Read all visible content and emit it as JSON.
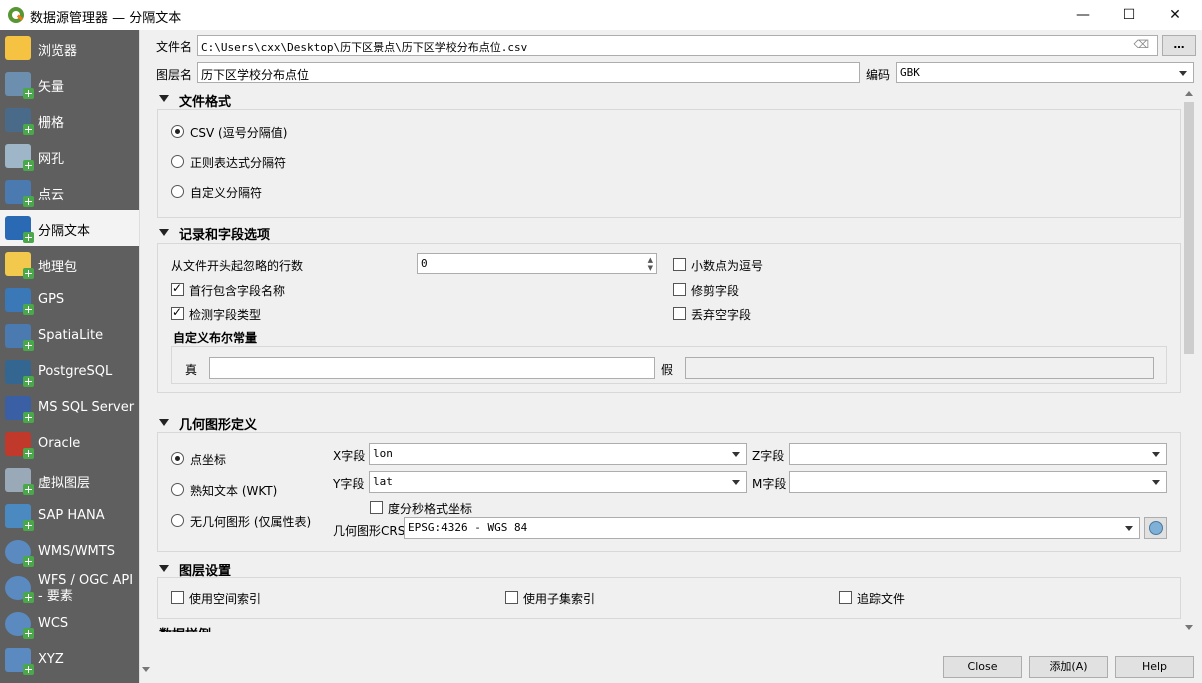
{
  "window": {
    "title": "数据源管理器 — 分隔文本",
    "minimize": "—",
    "maximize": "☐",
    "close": "✕"
  },
  "sidebar": {
    "items": [
      {
        "label": "浏览器",
        "icon": "folder-icon"
      },
      {
        "label": "矢量",
        "icon": "vector-icon"
      },
      {
        "label": "栅格",
        "icon": "raster-icon"
      },
      {
        "label": "网孔",
        "icon": "mesh-icon"
      },
      {
        "label": "点云",
        "icon": "point-cloud-icon"
      },
      {
        "label": "分隔文本",
        "icon": "delimited-text-icon"
      },
      {
        "label": "地理包",
        "icon": "geopackage-icon"
      },
      {
        "label": "GPS",
        "icon": "gps-icon"
      },
      {
        "label": "SpatiaLite",
        "icon": "spatialite-icon"
      },
      {
        "label": "PostgreSQL",
        "icon": "postgresql-icon"
      },
      {
        "label": "MS SQL Server",
        "icon": "mssql-icon"
      },
      {
        "label": "Oracle",
        "icon": "oracle-icon"
      },
      {
        "label": "虚拟图层",
        "icon": "virtual-layer-icon"
      },
      {
        "label": "SAP HANA",
        "icon": "sap-hana-icon"
      },
      {
        "label": "WMS/WMTS",
        "icon": "wms-icon"
      },
      {
        "label": "WFS / OGC API - 要素",
        "icon": "wfs-icon"
      },
      {
        "label": "WCS",
        "icon": "wcs-icon"
      },
      {
        "label": "XYZ",
        "icon": "xyz-icon"
      }
    ],
    "active": "分隔文本"
  },
  "file": {
    "label": "文件名",
    "value": "C:\\Users\\cxx\\Desktop\\历下区景点\\历下区学校分布点位.csv",
    "browse": "…"
  },
  "layer": {
    "label": "图层名",
    "value": "历下区学校分布点位",
    "encoding_label": "编码",
    "encoding_value": "GBK"
  },
  "file_format": {
    "title": "文件格式",
    "options": [
      "CSV (逗号分隔值)",
      "正则表达式分隔符",
      "自定义分隔符"
    ],
    "selected": "CSV (逗号分隔值)"
  },
  "record_options": {
    "title": "记录和字段选项",
    "skip_label": "从文件开头起忽略的行数",
    "skip_value": "0",
    "first_row_headers": {
      "label": "首行包含字段名称",
      "checked": true
    },
    "detect_types": {
      "label": "检测字段类型",
      "checked": true
    },
    "decimal_comma": {
      "label": "小数点为逗号",
      "checked": false
    },
    "trim_fields": {
      "label": "修剪字段",
      "checked": false
    },
    "discard_empty": {
      "label": "丢弃空字段",
      "checked": false
    },
    "custom_bool_title": "自定义布尔常量",
    "true_label": "真",
    "true_value": "",
    "false_label": "假",
    "false_value": ""
  },
  "geometry": {
    "title": "几何图形定义",
    "options": [
      "点坐标",
      "熟知文本 (WKT)",
      "无几何图形 (仅属性表)"
    ],
    "selected": "点坐标",
    "x_label": "X字段",
    "x_value": "lon",
    "y_label": "Y字段",
    "y_value": "lat",
    "z_label": "Z字段",
    "z_value": "",
    "m_label": "M字段",
    "m_value": "",
    "dms_label": "度分秒格式坐标",
    "dms_checked": false,
    "crs_label": "几何图形CRS",
    "crs_value": "EPSG:4326 - WGS 84"
  },
  "layer_settings": {
    "title": "图层设置",
    "spatial_index": {
      "label": "使用空间索引",
      "checked": false
    },
    "subset_index": {
      "label": "使用子集索引",
      "checked": false
    },
    "watch_file": {
      "label": "追踪文件",
      "checked": false
    }
  },
  "sample_data_title": "数据样例",
  "buttons": {
    "close": "Close",
    "add": "添加(A)",
    "help": "Help"
  }
}
